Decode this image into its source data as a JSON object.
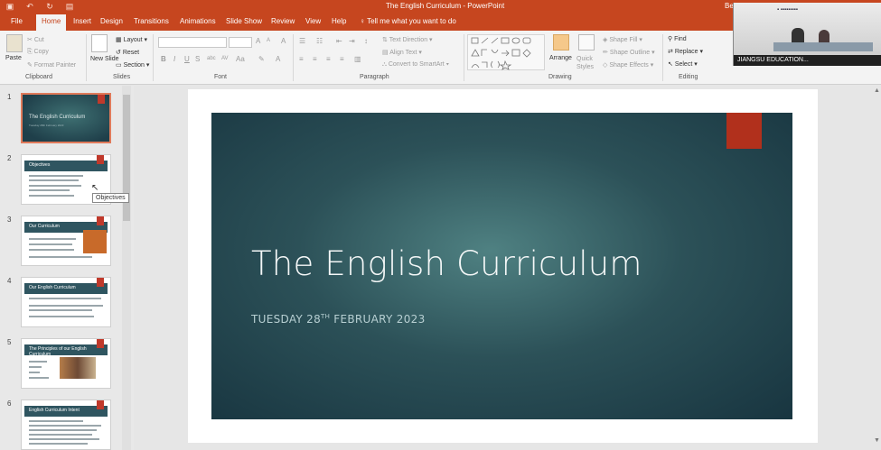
{
  "titlebar": {
    "title": "The English Curriculum  -  PowerPoint",
    "user": "Be",
    "qat_icons": [
      "save-icon",
      "undo-icon",
      "redo-icon",
      "present-icon"
    ]
  },
  "tabs": [
    "File",
    "Home",
    "Insert",
    "Design",
    "Transitions",
    "Animations",
    "Slide Show",
    "Review",
    "View",
    "Help"
  ],
  "active_tab": "Home",
  "tell_me": "Tell me what you want to do",
  "ribbon": {
    "clipboard": {
      "label": "Clipboard",
      "paste": "Paste",
      "cut": "Cut",
      "copy": "Copy",
      "format_painter": "Format Painter"
    },
    "slides": {
      "label": "Slides",
      "new_slide": "New Slide",
      "layout": "Layout",
      "reset": "Reset",
      "section": "Section"
    },
    "font": {
      "label": "Font",
      "bold": "B",
      "italic": "I",
      "underline": "U",
      "strike": "S",
      "grow": "A",
      "shrink": "A",
      "case": "Aa",
      "clear": "A"
    },
    "paragraph": {
      "label": "Paragraph",
      "text_direction": "Text Direction",
      "align_text": "Align Text",
      "convert_smartart": "Convert to SmartArt"
    },
    "drawing": {
      "label": "Drawing",
      "arrange": "Arrange",
      "quick_styles": "Quick Styles",
      "shape_fill": "Shape Fill",
      "shape_outline": "Shape Outline",
      "shape_effects": "Shape Effects"
    },
    "editing": {
      "label": "Editing",
      "find": "Find",
      "replace": "Replace",
      "select": "Select"
    }
  },
  "webcam": {
    "caption": "JIANGSU EDUCATION..."
  },
  "thumbnails": [
    {
      "num": "1",
      "title": "The English Curriculum",
      "sub": "Tuesday 28th February 2023",
      "selected": true
    },
    {
      "num": "2",
      "title": "Objectives"
    },
    {
      "num": "3",
      "title": "Our Curriculum"
    },
    {
      "num": "4",
      "title": "Our English Curriculum"
    },
    {
      "num": "5",
      "title": "The Principles of our English Curriculum"
    },
    {
      "num": "6",
      "title": "English Curriculum Intent"
    }
  ],
  "tooltip": "Objectives",
  "slide": {
    "title": "The English Curriculum",
    "subtitle_pre": "TUESDAY 28",
    "subtitle_sup": "TH",
    "subtitle_post": " FEBRUARY 2023",
    "accent": "#b1301c",
    "background": "#2c5158"
  },
  "colors": {
    "brand": "#c6461f",
    "ribbon": "#f3f3f3"
  }
}
